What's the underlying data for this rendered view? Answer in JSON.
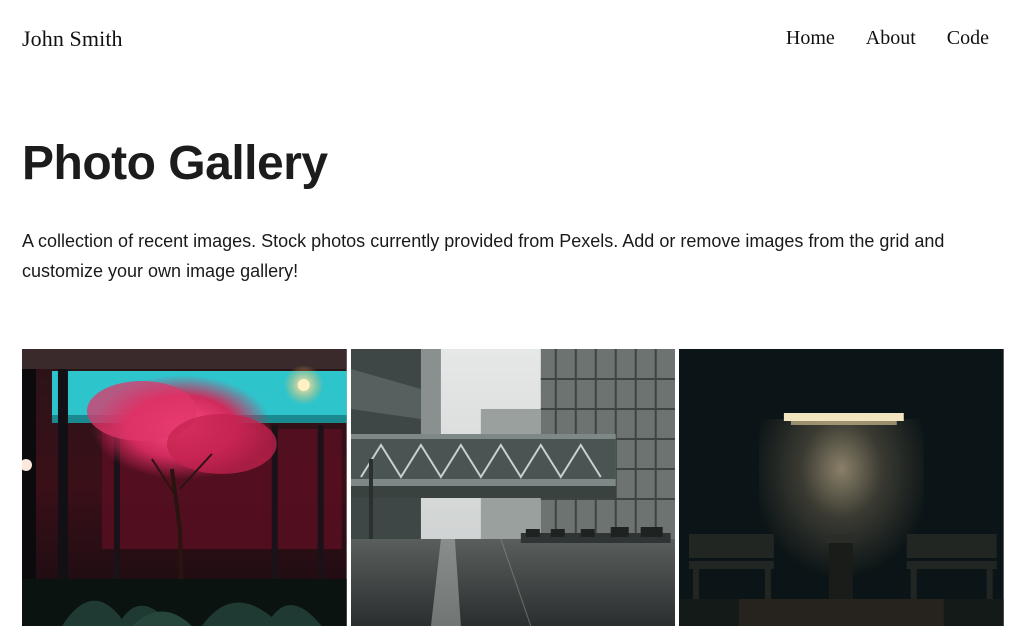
{
  "header": {
    "brand": "John Smith",
    "nav": [
      {
        "label": "Home"
      },
      {
        "label": "About"
      },
      {
        "label": "Code"
      }
    ]
  },
  "main": {
    "title": "Photo Gallery",
    "description": "A collection of recent images. Stock photos currently provided from Pexels. Add or remove images from the grid and customize your own image gallery!"
  },
  "gallery": {
    "images": [
      {
        "subject": "neon-lit red tree storefront at night"
      },
      {
        "subject": "skyway bridge between city buildings in rain"
      },
      {
        "subject": "dark wall with lamp and two benches"
      }
    ]
  }
}
